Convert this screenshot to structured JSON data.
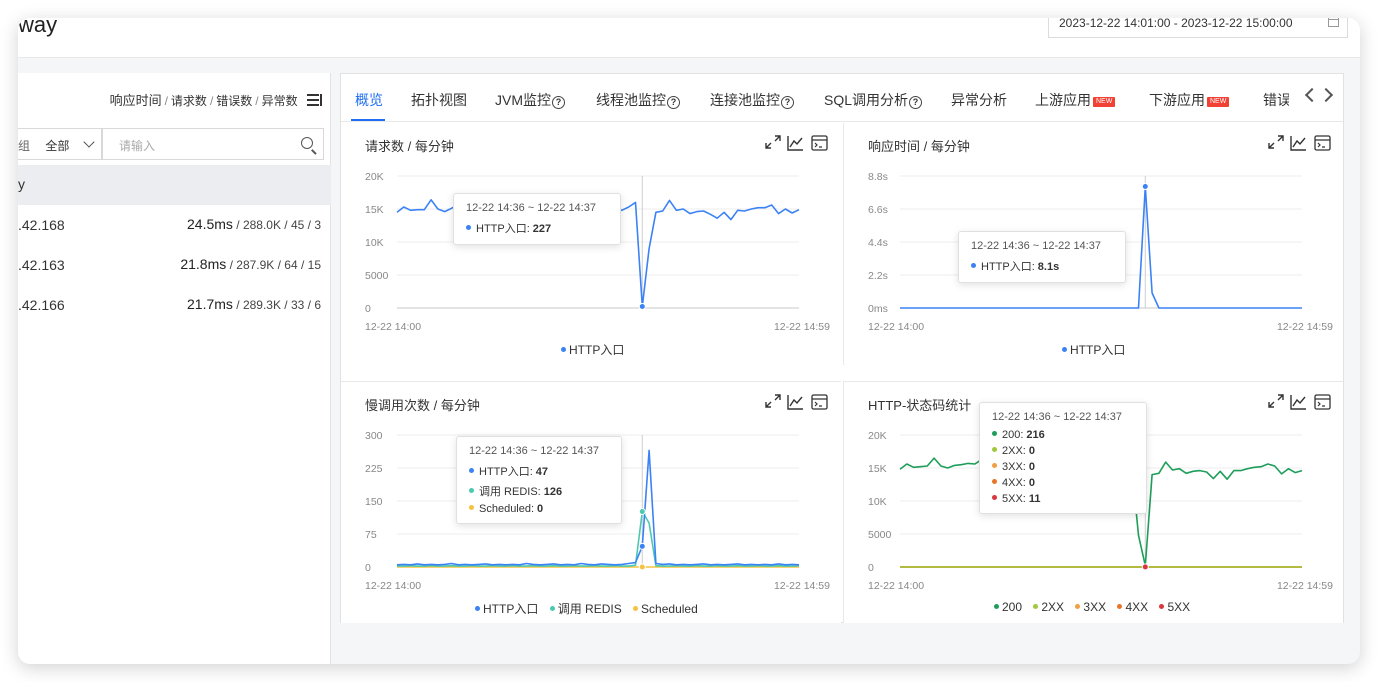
{
  "header": {
    "title": "way",
    "date_range": "2023-12-22 14:01:00 - 2023-12-22 15:00:00",
    "calendar_icon": "calendar-icon"
  },
  "left": {
    "metrics": {
      "latency": "响应时间",
      "requests": "请求数",
      "errors": "错误数",
      "exceptions": "异常数",
      "separator": "/"
    },
    "filter": {
      "group_fragment": "组",
      "group_value": "全部",
      "search_placeholder": "请输入"
    },
    "group_label": "y",
    "rows": [
      {
        "ip": ".42.168",
        "latency": "24.5ms",
        "rest": " / 288.0K / 45 / 3"
      },
      {
        "ip": ".42.163",
        "latency": "21.8ms",
        "rest": " / 287.9K / 64 / 15"
      },
      {
        "ip": ".42.166",
        "latency": "21.7ms",
        "rest": " / 289.3K / 33 / 6"
      }
    ]
  },
  "tabs": [
    {
      "label": "概览",
      "active": true
    },
    {
      "label": "拓扑视图"
    },
    {
      "label": "JVM监控",
      "help": true
    },
    {
      "label": "线程池监控",
      "help": true
    },
    {
      "label": "连接池监控",
      "help": true
    },
    {
      "label": "SQL调用分析",
      "help": true
    },
    {
      "label": "异常分析"
    },
    {
      "label": "上游应用",
      "badge": "NEW"
    },
    {
      "label": "下游应用",
      "badge": "NEW"
    },
    {
      "label": "错误"
    }
  ],
  "colors": {
    "blue": "#3b82f6",
    "teal": "#4cc9b0",
    "yellow": "#f5c242",
    "green": "#1e9e5a",
    "lime": "#a0c83c",
    "orange": "#f0a040",
    "dorange": "#e8742a",
    "red": "#d9363e",
    "accent": "#1f6ff0"
  },
  "cards": {
    "requests": {
      "title": "请求数 / 每分钟",
      "tooltip": {
        "time": "12-22 14:36 ~ 12-22 14:37",
        "rows": [
          {
            "name": "HTTP入口:",
            "value": "227"
          }
        ]
      },
      "legend": [
        "HTTP入口"
      ]
    },
    "latency": {
      "title": "响应时间 / 每分钟",
      "tooltip": {
        "time": "12-22 14:36 ~ 12-22 14:37",
        "rows": [
          {
            "name": "HTTP入口:",
            "value": "8.1s"
          }
        ]
      },
      "legend": [
        "HTTP入口"
      ]
    },
    "slow": {
      "title": "慢调用次数 / 每分钟",
      "tooltip": {
        "time": "12-22 14:36 ~ 12-22 14:37",
        "rows": [
          {
            "name": "HTTP入口:",
            "value": "47"
          },
          {
            "name": "调用 REDIS:",
            "value": "126"
          },
          {
            "name": "Scheduled:",
            "value": "0"
          }
        ]
      },
      "legend": [
        "HTTP入口",
        "调用 REDIS",
        "Scheduled"
      ]
    },
    "status": {
      "title": "HTTP-状态码统计",
      "tooltip": {
        "time": "12-22 14:36 ~ 12-22 14:37",
        "rows": [
          {
            "name": "200:",
            "value": "216"
          },
          {
            "name": "2XX:",
            "value": "0"
          },
          {
            "name": "3XX:",
            "value": "0"
          },
          {
            "name": "4XX:",
            "value": "0"
          },
          {
            "name": "5XX:",
            "value": "11"
          }
        ]
      },
      "legend": [
        "200",
        "2XX",
        "3XX",
        "4XX",
        "5XX"
      ]
    }
  },
  "chart_data": [
    {
      "type": "line",
      "title": "请求数 / 每分钟",
      "x_start": "12-22 14:00",
      "x_end": "12-22 14:59",
      "yticks": [
        "20K",
        "15K",
        "10K",
        "5000",
        "0"
      ],
      "ylim": [
        0,
        20000
      ],
      "series": [
        {
          "name": "HTTP入口",
          "values": [
            14500,
            15300,
            14800,
            14900,
            14900,
            16400,
            15000,
            14600,
            15100,
            15700,
            14900,
            15400,
            17000,
            16000,
            15500,
            15200,
            15400,
            14800,
            15000,
            15100,
            15300,
            14900,
            15200,
            15100,
            15400,
            15000,
            15400,
            15000,
            15200,
            15400,
            14900,
            14600,
            15100,
            14800,
            15300,
            16000,
            227,
            9000,
            14500,
            14700,
            16300,
            14800,
            15000,
            14300,
            14600,
            14700,
            14200,
            13600,
            14500,
            13400,
            14800,
            14700,
            15000,
            15200,
            15200,
            15600,
            14300,
            15000,
            14400,
            14900
          ]
        }
      ]
    },
    {
      "type": "line",
      "title": "响应时间 / 每分钟",
      "x_start": "12-22 14:00",
      "x_end": "12-22 14:59",
      "yticks": [
        "8.8s",
        "6.6s",
        "4.4s",
        "2.2s",
        "0ms"
      ],
      "ylim": [
        0,
        8.8
      ],
      "series": [
        {
          "name": "HTTP入口",
          "values": [
            0,
            0,
            0,
            0,
            0,
            0,
            0,
            0,
            0,
            0,
            0,
            0,
            0,
            0,
            0,
            0,
            0,
            0,
            0,
            0,
            0,
            0,
            0,
            0,
            0,
            0,
            0,
            0,
            0,
            0,
            0,
            0,
            0,
            0,
            0,
            0,
            8.1,
            1.0,
            0,
            0,
            0,
            0,
            0,
            0,
            0,
            0,
            0,
            0,
            0,
            0,
            0,
            0,
            0,
            0,
            0,
            0,
            0,
            0,
            0,
            0
          ]
        }
      ]
    },
    {
      "type": "line",
      "title": "慢调用次数 / 每分钟",
      "x_start": "12-22 14:00",
      "x_end": "12-22 14:59",
      "yticks": [
        "300",
        "225",
        "150",
        "75",
        "0"
      ],
      "ylim": [
        0,
        300
      ],
      "series": [
        {
          "name": "HTTP入口",
          "values": [
            5,
            6,
            5,
            7,
            5,
            6,
            5,
            6,
            8,
            5,
            6,
            5,
            6,
            7,
            5,
            6,
            5,
            6,
            5,
            8,
            6,
            5,
            6,
            7,
            5,
            6,
            5,
            8,
            6,
            5,
            7,
            6,
            5,
            6,
            8,
            10,
            47,
            265,
            8,
            6,
            7,
            5,
            6,
            5,
            6,
            7,
            5,
            6,
            5,
            6,
            7,
            5,
            6,
            5,
            6,
            5,
            7,
            5,
            6,
            5
          ]
        },
        {
          "name": "调用 REDIS",
          "values": [
            2,
            2,
            3,
            2,
            2,
            3,
            2,
            2,
            3,
            2,
            2,
            3,
            2,
            2,
            3,
            2,
            2,
            3,
            2,
            2,
            3,
            2,
            2,
            3,
            2,
            2,
            3,
            2,
            2,
            3,
            2,
            2,
            3,
            2,
            2,
            4,
            126,
            100,
            3,
            2,
            2,
            3,
            2,
            2,
            3,
            2,
            2,
            3,
            2,
            2,
            3,
            2,
            2,
            3,
            2,
            2,
            3,
            2,
            2,
            3
          ]
        },
        {
          "name": "Scheduled",
          "values": [
            0,
            0,
            0,
            0,
            0,
            0,
            0,
            0,
            0,
            0,
            0,
            0,
            0,
            0,
            0,
            0,
            0,
            0,
            0,
            0,
            0,
            0,
            0,
            0,
            0,
            0,
            0,
            0,
            0,
            0,
            0,
            0,
            0,
            0,
            0,
            0,
            0,
            0,
            0,
            0,
            0,
            0,
            0,
            0,
            0,
            0,
            0,
            0,
            0,
            0,
            0,
            0,
            0,
            0,
            0,
            0,
            0,
            0,
            0,
            0
          ]
        }
      ]
    },
    {
      "type": "line",
      "title": "HTTP-状态码统计",
      "x_start": "12-22 14:00",
      "x_end": "12-22 14:59",
      "yticks": [
        "20K",
        "15K",
        "10K",
        "5000",
        "0"
      ],
      "ylim": [
        0,
        20000
      ],
      "series": [
        {
          "name": "200",
          "values": [
            14800,
            15600,
            15100,
            15200,
            15300,
            16500,
            15300,
            15000,
            15400,
            15500,
            15700,
            15600,
            16300,
            15400,
            15600,
            15300,
            15500,
            15200,
            15400,
            15300,
            15500,
            15100,
            15300,
            15200,
            15400,
            15100,
            15400,
            15200,
            15300,
            15400,
            15000,
            14900,
            15200,
            15000,
            15300,
            4800,
            216,
            14000,
            14200,
            15900,
            14700,
            14900,
            14200,
            14500,
            14600,
            14400,
            13400,
            14500,
            13300,
            14600,
            14600,
            14900,
            15100,
            15200,
            15600,
            15300,
            14100,
            14900,
            14300,
            14600
          ]
        },
        {
          "name": "2XX",
          "values": [
            0,
            0,
            0,
            0,
            0,
            0,
            0,
            0,
            0,
            0,
            0,
            0,
            0,
            0,
            0,
            0,
            0,
            0,
            0,
            0,
            0,
            0,
            0,
            0,
            0,
            0,
            0,
            0,
            0,
            0,
            0,
            0,
            0,
            0,
            0,
            0,
            0,
            0,
            0,
            0,
            0,
            0,
            0,
            0,
            0,
            0,
            0,
            0,
            0,
            0,
            0,
            0,
            0,
            0,
            0,
            0,
            0,
            0,
            0,
            0
          ]
        },
        {
          "name": "3XX",
          "values": [
            0,
            0,
            0,
            0,
            0,
            0,
            0,
            0,
            0,
            0,
            0,
            0,
            0,
            0,
            0,
            0,
            0,
            0,
            0,
            0,
            0,
            0,
            0,
            0,
            0,
            0,
            0,
            0,
            0,
            0,
            0,
            0,
            0,
            0,
            0,
            0,
            0,
            0,
            0,
            0,
            0,
            0,
            0,
            0,
            0,
            0,
            0,
            0,
            0,
            0,
            0,
            0,
            0,
            0,
            0,
            0,
            0,
            0,
            0,
            0
          ]
        },
        {
          "name": "4XX",
          "values": [
            0,
            0,
            0,
            0,
            0,
            0,
            0,
            0,
            0,
            0,
            0,
            0,
            0,
            0,
            0,
            0,
            0,
            0,
            0,
            0,
            0,
            0,
            0,
            0,
            0,
            0,
            0,
            0,
            0,
            0,
            0,
            0,
            0,
            0,
            0,
            0,
            0,
            0,
            0,
            0,
            0,
            0,
            0,
            0,
            0,
            0,
            0,
            0,
            0,
            0,
            0,
            0,
            0,
            0,
            0,
            0,
            0,
            0,
            0,
            0
          ]
        },
        {
          "name": "5XX",
          "values": [
            0,
            0,
            0,
            0,
            0,
            0,
            0,
            0,
            0,
            0,
            0,
            0,
            0,
            0,
            0,
            0,
            0,
            0,
            0,
            0,
            0,
            0,
            0,
            0,
            0,
            0,
            0,
            0,
            0,
            0,
            0,
            0,
            0,
            0,
            0,
            0,
            11,
            0,
            0,
            0,
            0,
            0,
            0,
            0,
            0,
            0,
            0,
            0,
            0,
            0,
            0,
            0,
            0,
            0,
            0,
            0,
            0,
            0,
            0,
            0
          ]
        }
      ]
    }
  ]
}
